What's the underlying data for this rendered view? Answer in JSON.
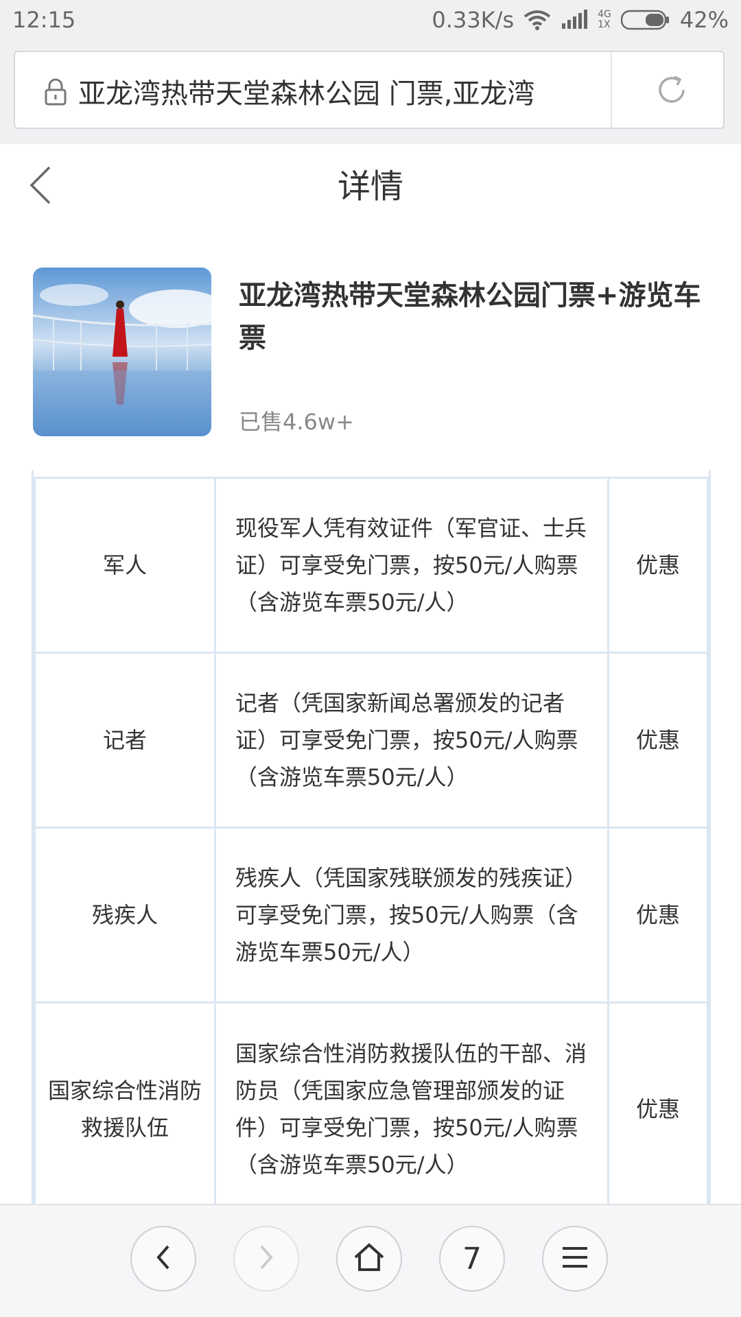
{
  "status_bar": {
    "time": "12:15",
    "speed": "0.33K/s",
    "net_top": "4G",
    "net_bottom": "1X",
    "battery": "42%"
  },
  "url_bar": {
    "text": "亚龙湾热带天堂森林公园 门票,亚龙湾"
  },
  "header": {
    "title": "详情"
  },
  "product": {
    "title": "亚龙湾热带天堂森林公园门票+游览车票",
    "sold": "已售4.6w+"
  },
  "table": {
    "rows": [
      {
        "category": "军人",
        "description": "现役军人凭有效证件（军官证、士兵证）可享受免门票，按50元/人购票（含游览车票50元/人）",
        "type": "优惠"
      },
      {
        "category": "记者",
        "description": "记者（凭国家新闻总署颁发的记者证）可享受免门票，按50元/人购票（含游览车票50元/人）",
        "type": "优惠"
      },
      {
        "category": "残疾人",
        "description": "残疾人（凭国家残联颁发的残疾证）可享受免门票，按50元/人购票（含游览车票50元/人）",
        "type": "优惠"
      },
      {
        "category": "国家综合性消防救援队伍",
        "description": "国家综合性消防救援队伍的干部、消防员（凭国家应急管理部颁发的证件）可享受免门票，按50元/人购票（含游览车票50元/人）",
        "type": "优惠"
      }
    ]
  },
  "bottom_bar": {
    "tab_count": "7",
    "buttons": [
      "back-icon",
      "forward-icon",
      "home-icon",
      "tabs",
      "menu-icon"
    ]
  },
  "colors": {
    "background": "#f0f0f2",
    "table_border": "#dbe7f2",
    "text": "#333333",
    "muted": "#888888"
  }
}
